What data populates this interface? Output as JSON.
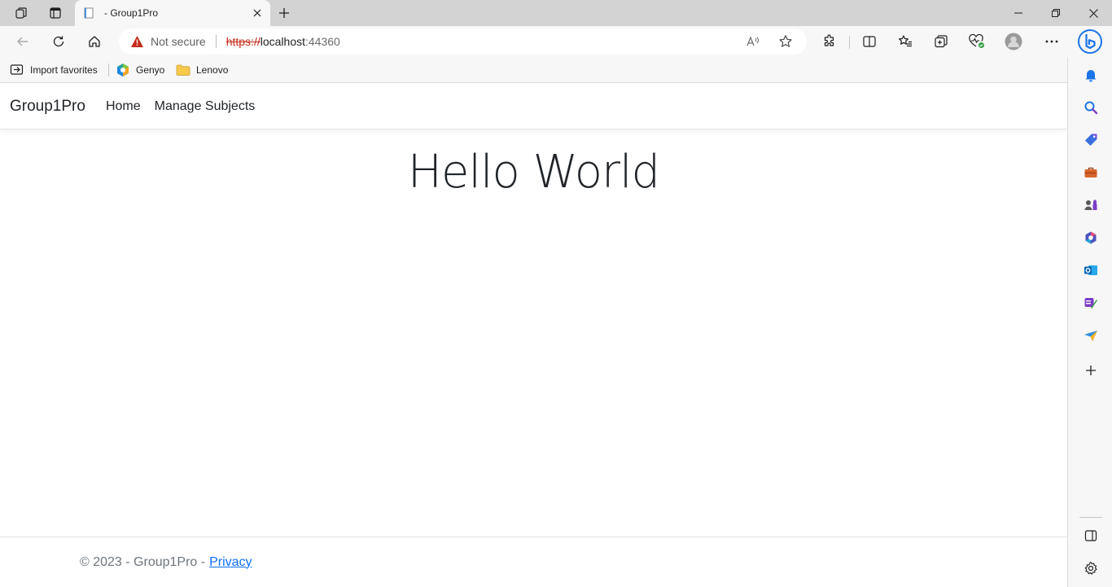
{
  "browser": {
    "tab": {
      "title": "- Group1Pro"
    },
    "address": {
      "security_label": "Not secure",
      "url_scheme": "https://",
      "url_host": "localhost",
      "url_port": ":44360"
    },
    "favorites": [
      {
        "label": "Import favorites",
        "icon": "import-icon"
      },
      {
        "label": "Genyo",
        "icon": "genyo-icon"
      },
      {
        "label": "Lenovo",
        "icon": "folder-icon"
      }
    ]
  },
  "page": {
    "navbar": {
      "brand": "Group1Pro",
      "links": [
        "Home",
        "Manage Subjects"
      ]
    },
    "heading": "Hello World",
    "footer": {
      "text": "© 2023 - Group1Pro -",
      "link": "Privacy"
    }
  },
  "colors": {
    "warning": "#c42b1c",
    "link": "#0d6efd",
    "bing": "#1a73e8"
  }
}
